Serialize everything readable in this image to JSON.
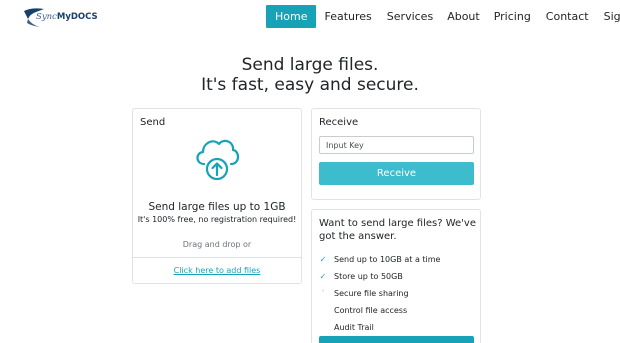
{
  "brand": {
    "sync": "Sync",
    "mydocs": "MyDOCS",
    "accent": "#17a2b8",
    "logo_color": "#17406b"
  },
  "nav": {
    "items": [
      {
        "label": "Home",
        "active": true
      },
      {
        "label": "Features"
      },
      {
        "label": "Services"
      },
      {
        "label": "About"
      },
      {
        "label": "Pricing"
      },
      {
        "label": "Contact"
      },
      {
        "label": "Sign In"
      }
    ]
  },
  "hero": {
    "line1": "Send large files.",
    "line2": "It's fast, easy and secure."
  },
  "send": {
    "title": "Send",
    "icon": "cloud-upload-icon",
    "headline": "Send large files up to 1GB",
    "subline": "It's 100% free, no registration required!",
    "drag_text": "Drag and drop or",
    "add_link": "Click here to add files"
  },
  "receive": {
    "title": "Receive",
    "input_placeholder": "Input Key",
    "button_label": "Receive"
  },
  "features": {
    "title": "Want to send large files? We've got the answer.",
    "items": [
      {
        "label": "Send up to 10GB at a time",
        "icon": "check-icon"
      },
      {
        "label": "Store up to 50GB",
        "icon": "check-icon"
      },
      {
        "label": "Secure file sharing",
        "icon": "check-icon"
      },
      {
        "label": "Control file access",
        "icon": ""
      },
      {
        "label": "Audit Trail",
        "icon": ""
      }
    ]
  }
}
